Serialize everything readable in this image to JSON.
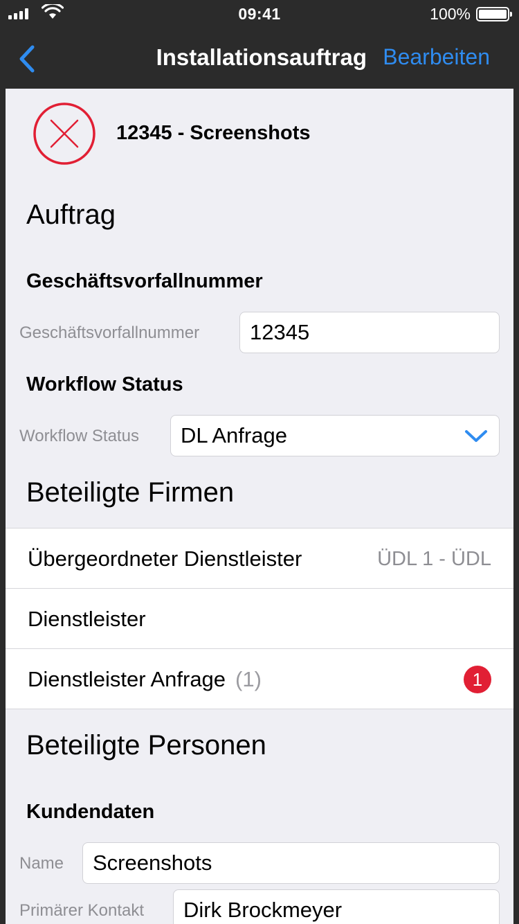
{
  "status_bar": {
    "time": "09:41",
    "battery": "100%"
  },
  "nav": {
    "title": "Installationsauftrag",
    "edit_label": "Bearbeiten",
    "back_icon": "chevron-left-icon"
  },
  "header": {
    "status_icon": "error-circle-icon",
    "order_title": "12345 - Screenshots"
  },
  "auftrag": {
    "section_title": "Auftrag",
    "gvn": {
      "heading": "Geschäftsvorfallnummer",
      "label": "Geschäftsvorfallnummer",
      "value": "12345"
    },
    "workflow": {
      "heading": "Workflow Status",
      "label": "Workflow Status",
      "value": "DL Anfrage"
    }
  },
  "firmen": {
    "section_title": "Beteiligte Firmen",
    "items": [
      {
        "label": "Übergeordneter Dienstleister",
        "value": "ÜDL 1 - ÜDL"
      },
      {
        "label": "Dienstleister"
      },
      {
        "label": "Dienstleister Anfrage",
        "count": "(1)",
        "badge": "1"
      }
    ]
  },
  "personen": {
    "section_title": "Beteiligte Personen",
    "kundendaten": {
      "heading": "Kundendaten",
      "name_label": "Name",
      "name_value": "Screenshots",
      "contact_label": "Primärer Kontakt",
      "contact_value": "Dirk Brockmeyer"
    }
  },
  "colors": {
    "accent": "#2f8cf0",
    "error": "#e11f34",
    "background": "#efeff4",
    "nav_bar": "#2b2b2b"
  }
}
